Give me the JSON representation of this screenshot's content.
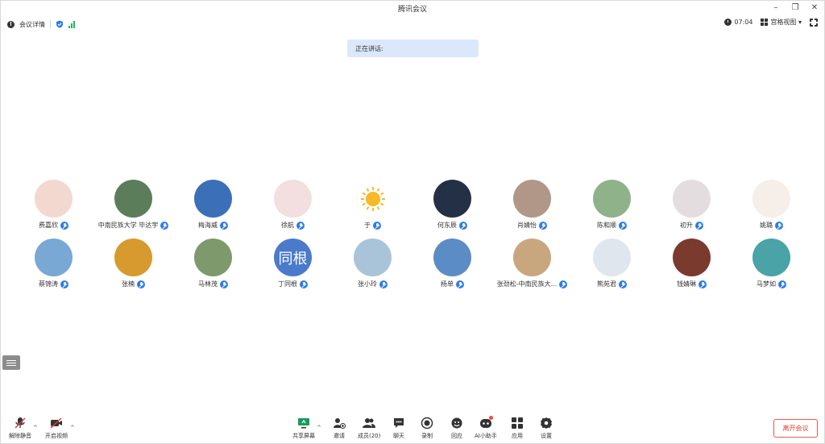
{
  "window": {
    "title": "腾讯会议"
  },
  "topbar": {
    "meeting_info": "会议详情",
    "timer": "07:04",
    "view_mode": "宫格视图"
  },
  "speaking": {
    "label": "正在讲话:"
  },
  "participants": [
    {
      "name": "费嘉欣",
      "bg": "#f2d8cf"
    },
    {
      "name": "中南民族大学 毕达宇",
      "bg": "#5b7d5a"
    },
    {
      "name": "梅海威",
      "bg": "#3b6fb8"
    },
    {
      "name": "徐航",
      "bg": "#f3dfe0"
    },
    {
      "name": "于",
      "bg": "#ffffff"
    },
    {
      "name": "何东辰",
      "bg": "#243046"
    },
    {
      "name": "肖婧怡",
      "bg": "#b09788"
    },
    {
      "name": "陈和顺",
      "bg": "#8fb28a"
    },
    {
      "name": "初升",
      "bg": "#e4dde0"
    },
    {
      "name": "姚璐",
      "bg": "#f5eee9"
    },
    {
      "name": "蔡锦涛",
      "bg": "#7aa8d4"
    },
    {
      "name": "张楠",
      "bg": "#d79a2e"
    },
    {
      "name": "马林茂",
      "bg": "#7e9a6c"
    },
    {
      "name": "丁同根",
      "bg": "#4a7bcb",
      "text": "同根"
    },
    {
      "name": "张小玲",
      "bg": "#a9c3d9"
    },
    {
      "name": "杨单",
      "bg": "#5c8cc6"
    },
    {
      "name": "张劲松-中南民族大...",
      "bg": "#c9a77e"
    },
    {
      "name": "熊苑君",
      "bg": "#dfe6ee"
    },
    {
      "name": "钱婧琳",
      "bg": "#7a3a2e"
    },
    {
      "name": "马梦如",
      "bg": "#4aa3a6"
    }
  ],
  "toolbar": {
    "unmute": "解除静音",
    "start_video": "开启视频",
    "share_screen": "共享屏幕",
    "invite": "邀请",
    "members": "成员(20)",
    "chat": "聊天",
    "record": "录制",
    "reactions": "回应",
    "ai_assistant": "AI小助手",
    "apps": "应用",
    "settings": "设置",
    "leave": "离开会议"
  },
  "colors": {
    "accent": "#2b7de9",
    "danger": "#e03e2f",
    "banner": "#dbe8fb",
    "signal": "#21b35c"
  }
}
